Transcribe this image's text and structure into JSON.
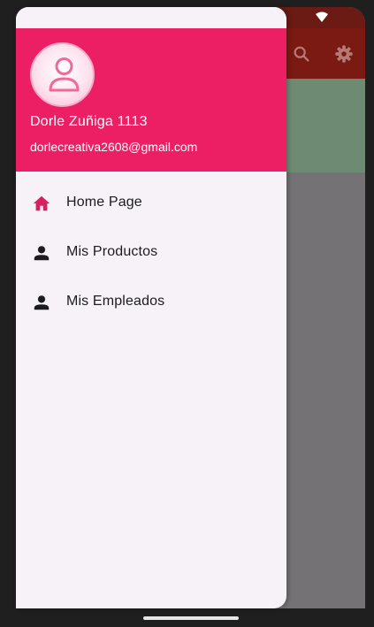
{
  "colors": {
    "header_bg": "#ec1f65",
    "drawer_bg": "#f6f2f7",
    "appbar_bg": "#7a1a13",
    "active_icon": "#d9205f",
    "inactive_icon": "#1c1b1f"
  },
  "appbar": {
    "icons": [
      "search-icon",
      "settings-icon"
    ]
  },
  "drawer": {
    "header": {
      "name": "Dorle Zuñiga 1113",
      "email": "dorlecreativa2608@gmail.com",
      "avatar_icon": "person-outline-icon"
    },
    "items": [
      {
        "label": "Home Page",
        "icon": "home-icon",
        "active": true
      },
      {
        "label": "Mis Productos",
        "icon": "person-icon",
        "active": false
      },
      {
        "label": "Mis Empleados",
        "icon": "person-icon",
        "active": false
      }
    ]
  }
}
